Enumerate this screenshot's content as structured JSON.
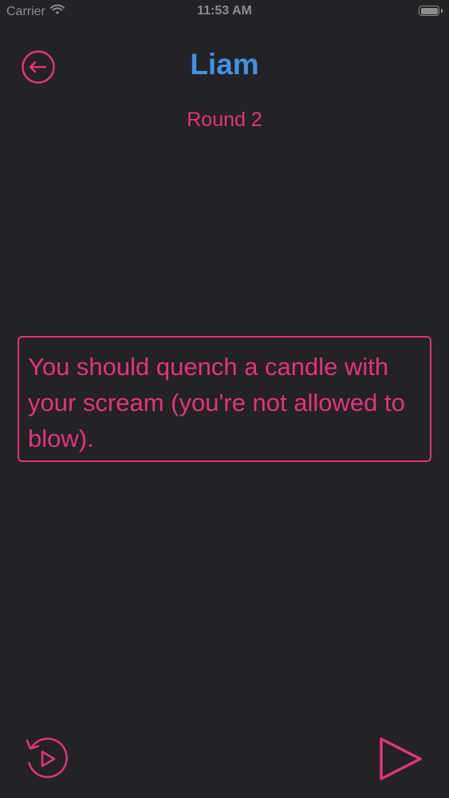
{
  "status_bar": {
    "carrier": "Carrier",
    "time": "11:53 AM",
    "wifi_icon": "wifi-icon",
    "battery_icon": "battery-icon"
  },
  "header": {
    "back_icon": "arrow-left-circle-icon",
    "player_name": "Liam",
    "round_label": "Round 2"
  },
  "task": {
    "text": "You should quench a candle with your scream (you're not allowed to blow)."
  },
  "footer": {
    "replay_icon": "replay-circle-icon",
    "next_icon": "play-triangle-icon"
  },
  "colors": {
    "background": "#232224",
    "accent_pink": "#e3337f",
    "title_blue": "#3f93e4",
    "status_gray": "#8e8e8e"
  }
}
